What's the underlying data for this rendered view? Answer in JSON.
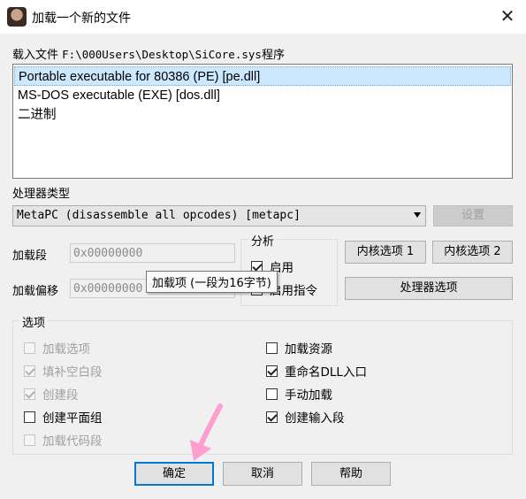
{
  "window": {
    "title": "加载一个新的文件",
    "icon": "app-portrait-icon",
    "close_glyph": "✕"
  },
  "file_label_prefix": "载入文件",
  "file_path": "F:\\000Users\\Desktop\\SiCore.sys",
  "file_label_suffix": "程序",
  "loaders": [
    "Portable executable for 80386 (PE) [pe.dll]",
    "MS-DOS executable (EXE) [dos.dll]",
    "二进制"
  ],
  "selected_loader_index": 0,
  "processor": {
    "label": "处理器类型",
    "value": "MetaPC (disassemble all opcodes) [metapc]",
    "settings_button": "设置"
  },
  "load_segment": {
    "label": "加载段",
    "value": "0x00000000"
  },
  "load_offset": {
    "label": "加载偏移",
    "value": "0x00000000"
  },
  "analysis": {
    "title": "分析",
    "enable_label": "启用",
    "enable_checked": true,
    "indicator_label": "启用指令",
    "indicator_checked": false
  },
  "kernel_options_1": "内核选项 1",
  "kernel_options_2": "内核选项 2",
  "processor_options": "处理器选项",
  "tooltip": "加载项 (一段为16字节)",
  "options": {
    "title": "选项",
    "left": [
      {
        "label": "加载选项",
        "checked": false,
        "enabled": false
      },
      {
        "label": "填补空白段",
        "checked": true,
        "enabled": false
      },
      {
        "label": "创建段",
        "checked": true,
        "enabled": false
      },
      {
        "label": "创建平面组",
        "checked": false,
        "enabled": true
      },
      {
        "label": "加载代码段",
        "checked": false,
        "enabled": false
      }
    ],
    "right": [
      {
        "label": "加载资源",
        "checked": false,
        "enabled": true
      },
      {
        "label": "重命名DLL入口",
        "checked": true,
        "enabled": true
      },
      {
        "label": "手动加载",
        "checked": false,
        "enabled": true
      },
      {
        "label": "创建输入段",
        "checked": true,
        "enabled": true
      }
    ]
  },
  "buttons": {
    "ok": "确定",
    "cancel": "取消",
    "help": "帮助"
  },
  "colors": {
    "accent": "#0078d7",
    "selection": "#cce8ff",
    "annotation_arrow": "#ff9ecf"
  }
}
